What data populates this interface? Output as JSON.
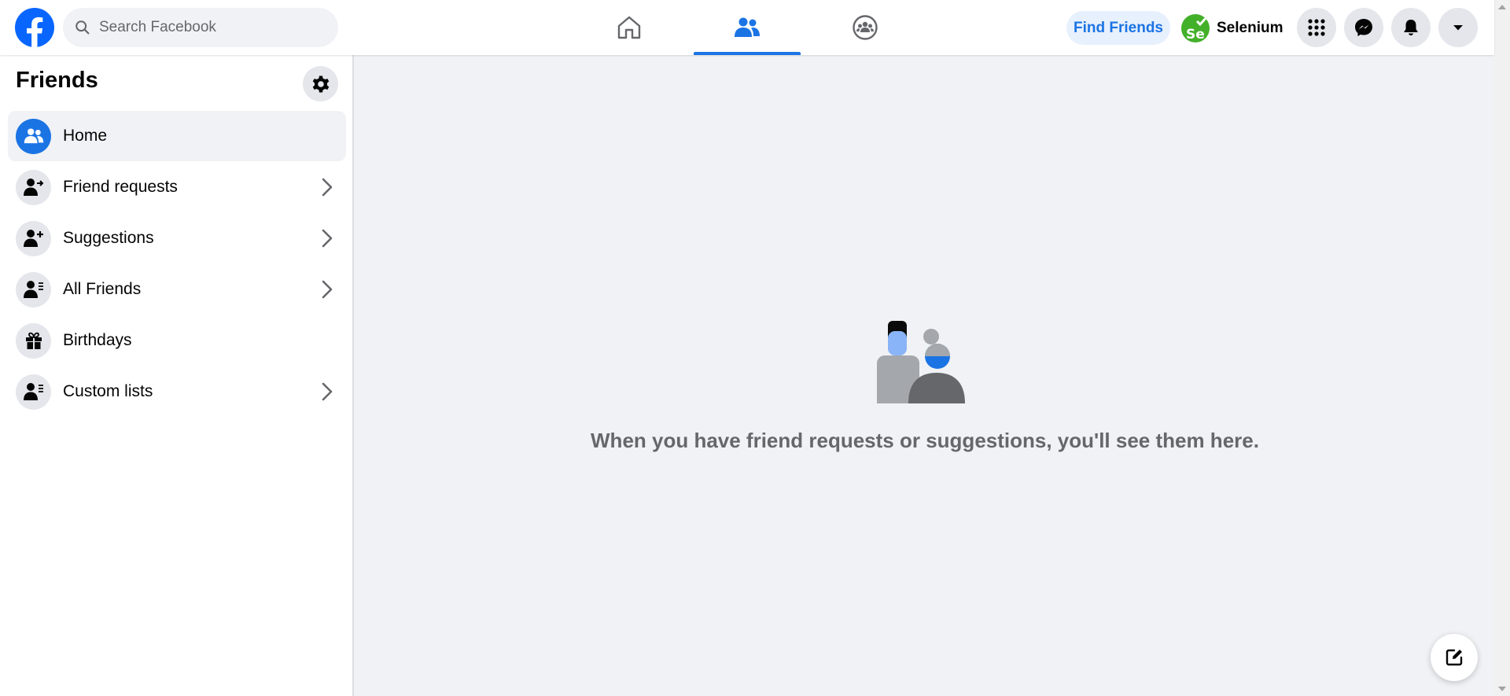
{
  "header": {
    "search_placeholder": "Search Facebook",
    "find_friends_label": "Find Friends",
    "profile_name": "Selenium",
    "profile_avatar_text": "Se",
    "nav_tabs": [
      {
        "icon": "home-icon",
        "active": false
      },
      {
        "icon": "friends-icon",
        "active": true
      },
      {
        "icon": "groups-icon",
        "active": false
      }
    ],
    "right_buttons": [
      "menu-grid-icon",
      "messenger-icon",
      "notifications-bell-icon",
      "account-caret-icon"
    ]
  },
  "sidebar": {
    "title": "Friends",
    "items": [
      {
        "label": "Home",
        "icon": "friends-icon",
        "active": true,
        "has_chevron": false
      },
      {
        "label": "Friend requests",
        "icon": "friend-request-icon",
        "active": false,
        "has_chevron": true
      },
      {
        "label": "Suggestions",
        "icon": "add-friend-icon",
        "active": false,
        "has_chevron": true
      },
      {
        "label": "All Friends",
        "icon": "friend-list-icon",
        "active": false,
        "has_chevron": true
      },
      {
        "label": "Birthdays",
        "icon": "gift-icon",
        "active": false,
        "has_chevron": false
      },
      {
        "label": "Custom lists",
        "icon": "friend-list-icon",
        "active": false,
        "has_chevron": true
      }
    ]
  },
  "main": {
    "empty_message": "When you have friend requests or suggestions, you'll see them here."
  },
  "colors": {
    "brand_blue": "#1b74e4",
    "page_bg": "#f0f2f5",
    "secondary_text": "#65676b"
  }
}
